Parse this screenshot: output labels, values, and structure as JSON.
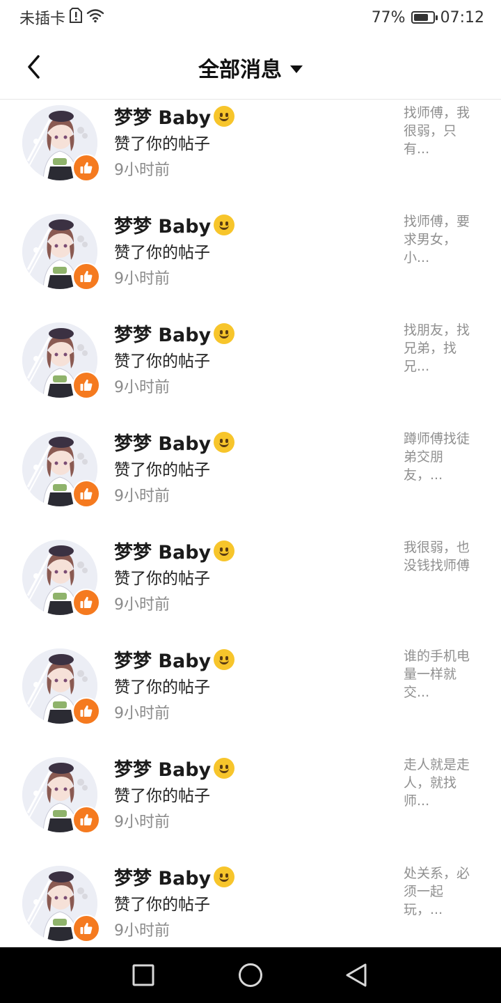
{
  "status_bar": {
    "carrier": "未插卡",
    "battery_percent": "77%",
    "battery_level": 0.77,
    "time": "07:12"
  },
  "header": {
    "title": "全部消息"
  },
  "notifications": [
    {
      "user": "梦梦 Baby",
      "action": "赞了你的帖子",
      "time": "9小时前",
      "snippet": "找师傅，我很弱，只有..."
    },
    {
      "user": "梦梦 Baby",
      "action": "赞了你的帖子",
      "time": "9小时前",
      "snippet": "找师傅，要求男女，小..."
    },
    {
      "user": "梦梦 Baby",
      "action": "赞了你的帖子",
      "time": "9小时前",
      "snippet": "找朋友，找兄弟，找兄..."
    },
    {
      "user": "梦梦 Baby",
      "action": "赞了你的帖子",
      "time": "9小时前",
      "snippet": "蹲师傅找徒弟交朋友，..."
    },
    {
      "user": "梦梦 Baby",
      "action": "赞了你的帖子",
      "time": "9小时前",
      "snippet": "我很弱，也没钱找师傅"
    },
    {
      "user": "梦梦 Baby",
      "action": "赞了你的帖子",
      "time": "9小时前",
      "snippet": "谁的手机电量一样就交..."
    },
    {
      "user": "梦梦 Baby",
      "action": "赞了你的帖子",
      "time": "9小时前",
      "snippet": "走人就是走人，就找师..."
    },
    {
      "user": "梦梦 Baby",
      "action": "赞了你的帖子",
      "time": "9小时前",
      "snippet": "处关系，必须一起玩，..."
    }
  ],
  "colors": {
    "like_badge": "#f57a1f",
    "nav_bar": "#000000"
  },
  "icons": {
    "back": "chevron-left-icon",
    "dropdown": "caret-down-icon",
    "like": "thumbs-up-icon",
    "nav_recent": "square-icon",
    "nav_home": "circle-icon",
    "nav_back": "triangle-back-icon"
  }
}
